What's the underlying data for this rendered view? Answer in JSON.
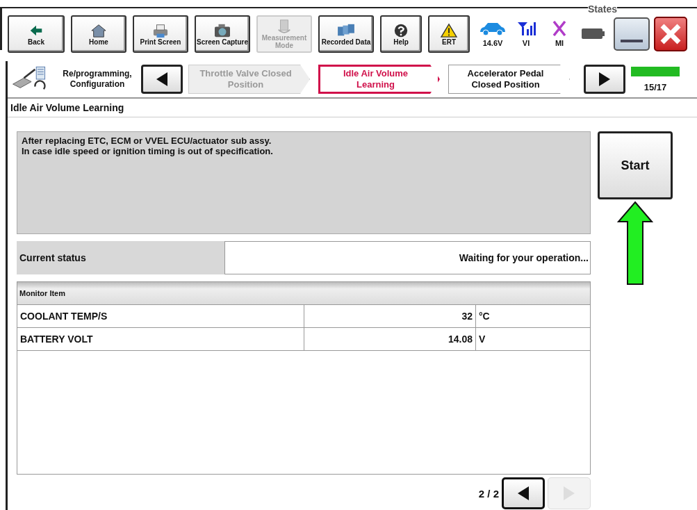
{
  "header_caption": "States",
  "toolbar": [
    {
      "kind": "back",
      "label": "Back",
      "disabled": false
    },
    {
      "kind": "home",
      "label": "Home",
      "disabled": false
    },
    {
      "kind": "printer",
      "label": "Print Screen",
      "disabled": false
    },
    {
      "kind": "camera",
      "label": "Screen Capture",
      "disabled": false
    },
    {
      "kind": "measure",
      "label": "Measurement Mode",
      "disabled": true
    },
    {
      "kind": "folders",
      "label": "Recorded Data",
      "disabled": false
    },
    {
      "kind": "help",
      "label": "Help",
      "disabled": false
    },
    {
      "kind": "warning",
      "label": "ERT",
      "disabled": false
    }
  ],
  "indicators": [
    {
      "kind": "car",
      "label": "14.6V"
    },
    {
      "kind": "signal",
      "label": "VI"
    },
    {
      "kind": "cross",
      "label": "MI"
    },
    {
      "kind": "battery"
    }
  ],
  "breadcrumb": {
    "label": "Re/programming, Configuration"
  },
  "steps": [
    {
      "label": "Throttle Valve Closed Position",
      "selected": false,
      "disabled": true
    },
    {
      "label": "Idle Air Volume Learning",
      "selected": true,
      "disabled": false
    },
    {
      "label": "Accelerator Pedal Closed Position",
      "selected": false,
      "disabled": false
    }
  ],
  "progress": {
    "level": 1,
    "label": "15/17"
  },
  "page_title": "Idle Air Volume Learning",
  "description": [
    "After replacing ETC, ECM or VVEL ECU/actuator sub assy.",
    "In case idle speed or ignition timing is out of specification."
  ],
  "start_button": "Start",
  "status": {
    "label": "Current status",
    "value": "Waiting for your operation..."
  },
  "monitor": {
    "header": "Monitor Item",
    "rows": [
      {
        "item": "COOLANT TEMP/S",
        "value": "32",
        "unit": "°C"
      },
      {
        "item": "BATTERY VOLT",
        "value": "14.08",
        "unit": "V"
      }
    ]
  },
  "pager": {
    "label": "2 / 2",
    "prev_disabled": false,
    "next_disabled": true
  }
}
